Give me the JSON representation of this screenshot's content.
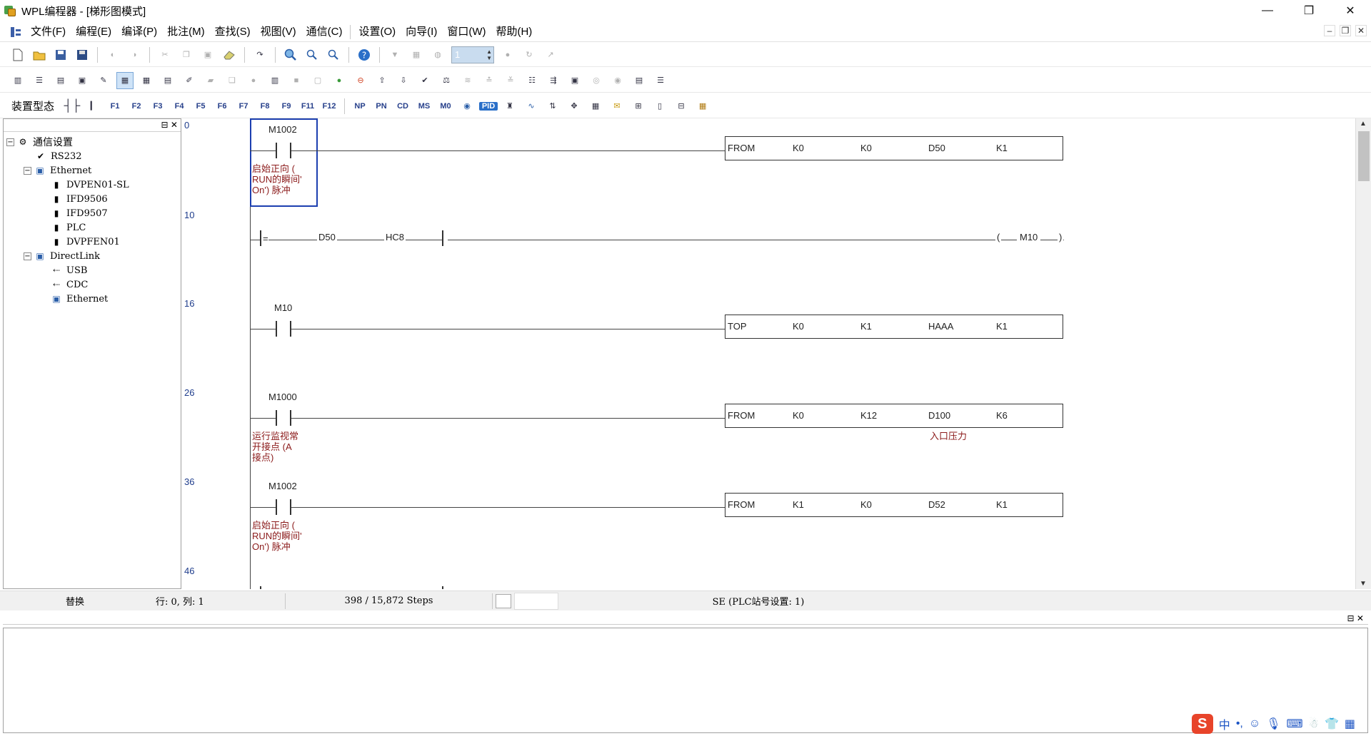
{
  "window": {
    "title": "WPL编程器 - [梯形图模式]",
    "controls": {
      "minimize": "—",
      "maximize": "❐",
      "close": "✕"
    }
  },
  "menu": {
    "items": [
      "文件(F)",
      "编程(E)",
      "编译(P)",
      "批注(M)",
      "查找(S)",
      "视图(V)",
      "通信(C)",
      "设置(O)",
      "向导(I)",
      "窗口(W)",
      "帮助(H)"
    ],
    "mdi": {
      "minimize": "–",
      "restore": "❐",
      "close": "✕"
    }
  },
  "toolbar1": {
    "spin_value": "1"
  },
  "toolbar3": {
    "mode_label": "装置型态",
    "fkeys": [
      "F1",
      "F2",
      "F3",
      "F4",
      "F5",
      "F6",
      "F7",
      "F8",
      "F9",
      "F11",
      "F12",
      "NP",
      "PN",
      "CD",
      "MS",
      "M0",
      "PID"
    ]
  },
  "tree": {
    "root": "通信设置",
    "items": [
      {
        "label": "RS232",
        "level": 1,
        "icon": "check-icon"
      },
      {
        "label": "Ethernet",
        "level": 1,
        "icon": "network-icon",
        "expanded": true
      },
      {
        "label": "DVPEN01-SL",
        "level": 2,
        "icon": "device-icon"
      },
      {
        "label": "IFD9506",
        "level": 2,
        "icon": "device-icon"
      },
      {
        "label": "IFD9507",
        "level": 2,
        "icon": "device-icon"
      },
      {
        "label": "PLC",
        "level": 2,
        "icon": "device-icon"
      },
      {
        "label": "DVPFEN01",
        "level": 2,
        "icon": "device-icon"
      },
      {
        "label": "DirectLink",
        "level": 1,
        "icon": "link-icon",
        "expanded": true
      },
      {
        "label": "USB",
        "level": 2,
        "icon": "usb-icon"
      },
      {
        "label": "CDC",
        "level": 2,
        "icon": "usb-icon"
      },
      {
        "label": "Ethernet",
        "level": 2,
        "icon": "network-icon"
      }
    ]
  },
  "ladder": {
    "steps": [
      "0",
      "10",
      "16",
      "26",
      "36",
      "46"
    ],
    "rung0": {
      "contact": "M1002",
      "comment": "启始正向 (\nRUN的瞬间'\nOn') 脉冲",
      "instr": [
        "FROM",
        "K0",
        "K0",
        "D50",
        "K1"
      ]
    },
    "rung10": {
      "op": "=",
      "a": "D50",
      "b": "HC8",
      "coil_open": "(",
      "coil": "M10",
      "coil_close": ")"
    },
    "rung16": {
      "contact": "M10",
      "instr": [
        "TOP",
        "K0",
        "K1",
        "HAAA",
        "K1"
      ]
    },
    "rung26": {
      "contact": "M1000",
      "comment": "运行监视常\n开接点 (A\n接点)",
      "instr": [
        "FROM",
        "K0",
        "K12",
        "D100",
        "K6"
      ],
      "instr_comment": "入口压力"
    },
    "rung36": {
      "contact": "M1002",
      "comment": "启始正向 (\nRUN的瞬间'\nOn') 脉冲",
      "instr": [
        "FROM",
        "K1",
        "K0",
        "D52",
        "K1"
      ]
    }
  },
  "status": {
    "mode": "替换",
    "position": "行: 0, 列: 1",
    "steps": "398 / 15,872 Steps",
    "plc": "SE (PLC站号设置: 1)"
  },
  "ime": {
    "logo": "S",
    "lang": "中",
    "punct": "•,"
  }
}
